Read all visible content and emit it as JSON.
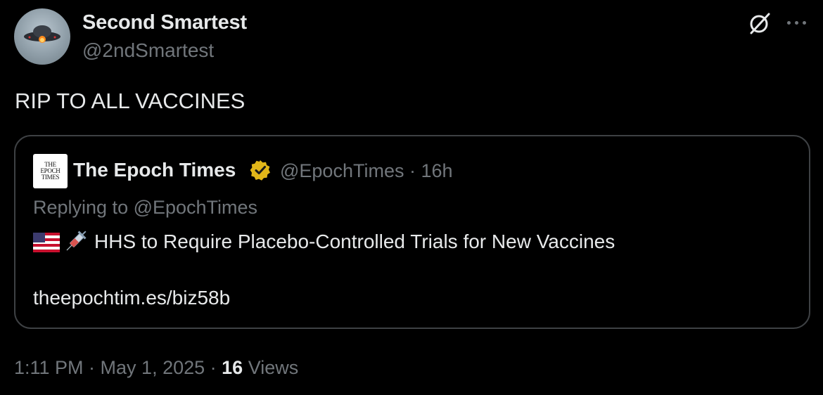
{
  "author": {
    "display_name": "Second Smartest",
    "handle": "@2ndSmartest",
    "avatar_icon": "ufo-avatar"
  },
  "header_icons": {
    "grok": "grok-icon",
    "more": "more-options-icon"
  },
  "tweet": {
    "text": "RIP TO ALL VACCINES"
  },
  "quoted": {
    "logo_lines": [
      "THE",
      "EPOCH",
      "TIMES"
    ],
    "display_name": "The Epoch Times",
    "verified_badge_color": "#e2b719",
    "handle_and_time": "@EpochTimes · 16h",
    "replying_to": "Replying to @EpochTimes",
    "emojis": [
      "us-flag-icon",
      "syringe-icon"
    ],
    "headline": "HHS to Require Placebo-Controlled Trials for New Vaccines",
    "link": "theepochtim.es/biz58b"
  },
  "meta": {
    "timestamp": "1:11 PM · May 1, 2025 · ",
    "views_count": "16",
    "views_label": " Views"
  },
  "colors": {
    "background": "#000000",
    "primary_text": "#e7e9ea",
    "secondary_text": "#71767b",
    "card_border": "#3e4144"
  }
}
